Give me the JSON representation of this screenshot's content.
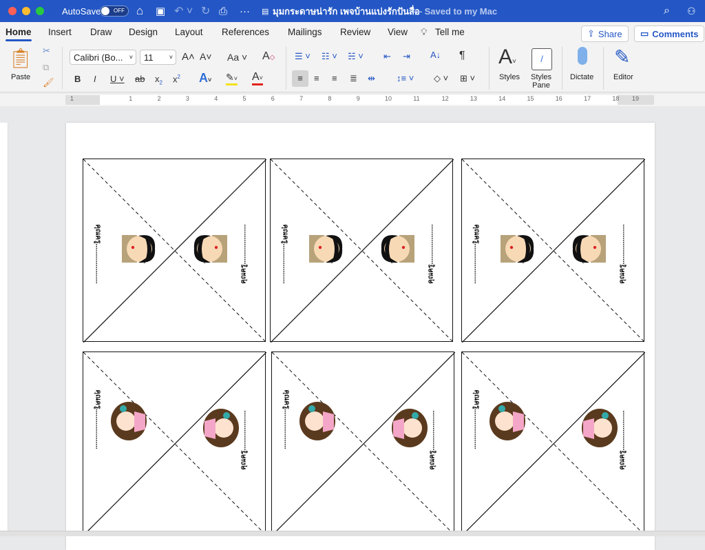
{
  "titlebar": {
    "autosave": "AutoSave",
    "toggle": "OFF",
    "title": "มุมกระดาษน่ารัก เพจบ้านแบ่งรักปันสื่อ",
    "saved": "— Saved to my Mac"
  },
  "tabs": [
    "Home",
    "Insert",
    "Draw",
    "Design",
    "Layout",
    "References",
    "Mailings",
    "Review",
    "View",
    "Tell me"
  ],
  "share": "Share",
  "comments": "Comments",
  "ribbon": {
    "paste": "Paste",
    "font": "Calibri (Bo...",
    "size": "11",
    "styles": "Styles",
    "styles_pane_1": "Styles",
    "styles_pane_2": "Pane",
    "dictate": "Dictate",
    "editor": "Editor",
    "bold": "B",
    "italic": "I",
    "underline": "U",
    "strike": "ab",
    "sub": "x",
    "sup": "x",
    "grow": "A",
    "shrink": "A",
    "case": "Aa",
    "pilcrow": "¶"
  },
  "ruler": [
    "1",
    "1",
    "2",
    "3",
    "4",
    "5",
    "6",
    "7",
    "8",
    "9",
    "10",
    "11",
    "12",
    "13",
    "14",
    "15",
    "16",
    "17",
    "18",
    "19"
  ],
  "card_label": "คุณครู.....................",
  "cards": [
    "boy",
    "boy",
    "boy",
    "girl",
    "girl",
    "girl"
  ],
  "colors": {
    "accent": "#2457c5"
  }
}
